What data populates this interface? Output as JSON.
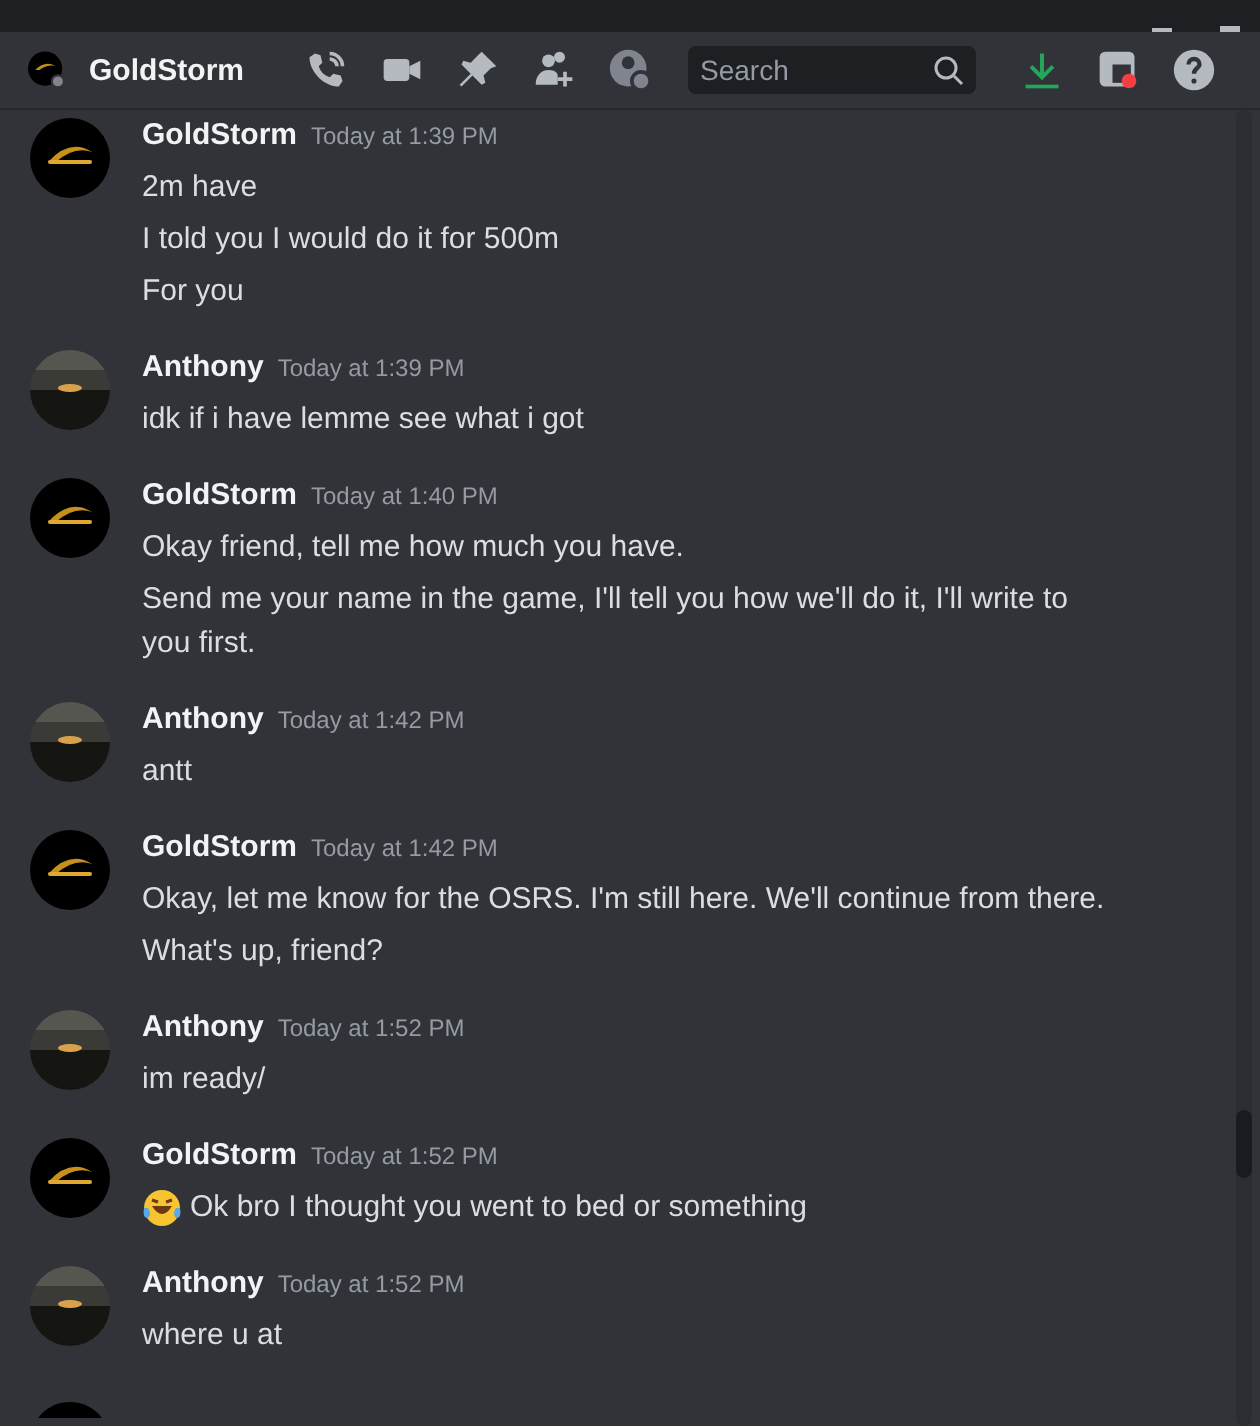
{
  "header": {
    "title": "GoldStorm",
    "search": {
      "placeholder": "Search"
    }
  },
  "messages": [
    {
      "author": "GoldStorm",
      "kind": "logo",
      "time": "Today at 1:39 PM",
      "lines": [
        {
          "text": "2m have"
        },
        {
          "text": "I told you I would do it for 500m"
        },
        {
          "text": "For you"
        }
      ]
    },
    {
      "author": "Anthony",
      "kind": "photo",
      "time": "Today at 1:39 PM",
      "lines": [
        {
          "text": "idk if i have lemme see what i got"
        }
      ]
    },
    {
      "author": "GoldStorm",
      "kind": "logo",
      "time": "Today at 1:40 PM",
      "lines": [
        {
          "text": "Okay friend, tell me how much you have."
        },
        {
          "text": "Send me your name in the game, I'll tell you how we'll do it, I'll write to you first."
        }
      ]
    },
    {
      "author": "Anthony",
      "kind": "photo",
      "time": "Today at 1:42 PM",
      "lines": [
        {
          "text": "antt"
        }
      ]
    },
    {
      "author": "GoldStorm",
      "kind": "logo",
      "time": "Today at 1:42 PM",
      "lines": [
        {
          "text": "Okay, let me know for the OSRS. I'm still here. We'll continue from there."
        },
        {
          "text": "What's up, friend?"
        }
      ]
    },
    {
      "author": "Anthony",
      "kind": "photo",
      "time": "Today at 1:52 PM",
      "lines": [
        {
          "text": "im ready/"
        }
      ]
    },
    {
      "author": "GoldStorm",
      "kind": "logo",
      "time": "Today at 1:52 PM",
      "lines": [
        {
          "text": "Ok bro I thought you went to bed or something",
          "emoji": true
        }
      ]
    },
    {
      "author": "Anthony",
      "kind": "photo",
      "time": "Today at 1:52 PM",
      "lines": [
        {
          "text": "where u at"
        }
      ]
    }
  ]
}
